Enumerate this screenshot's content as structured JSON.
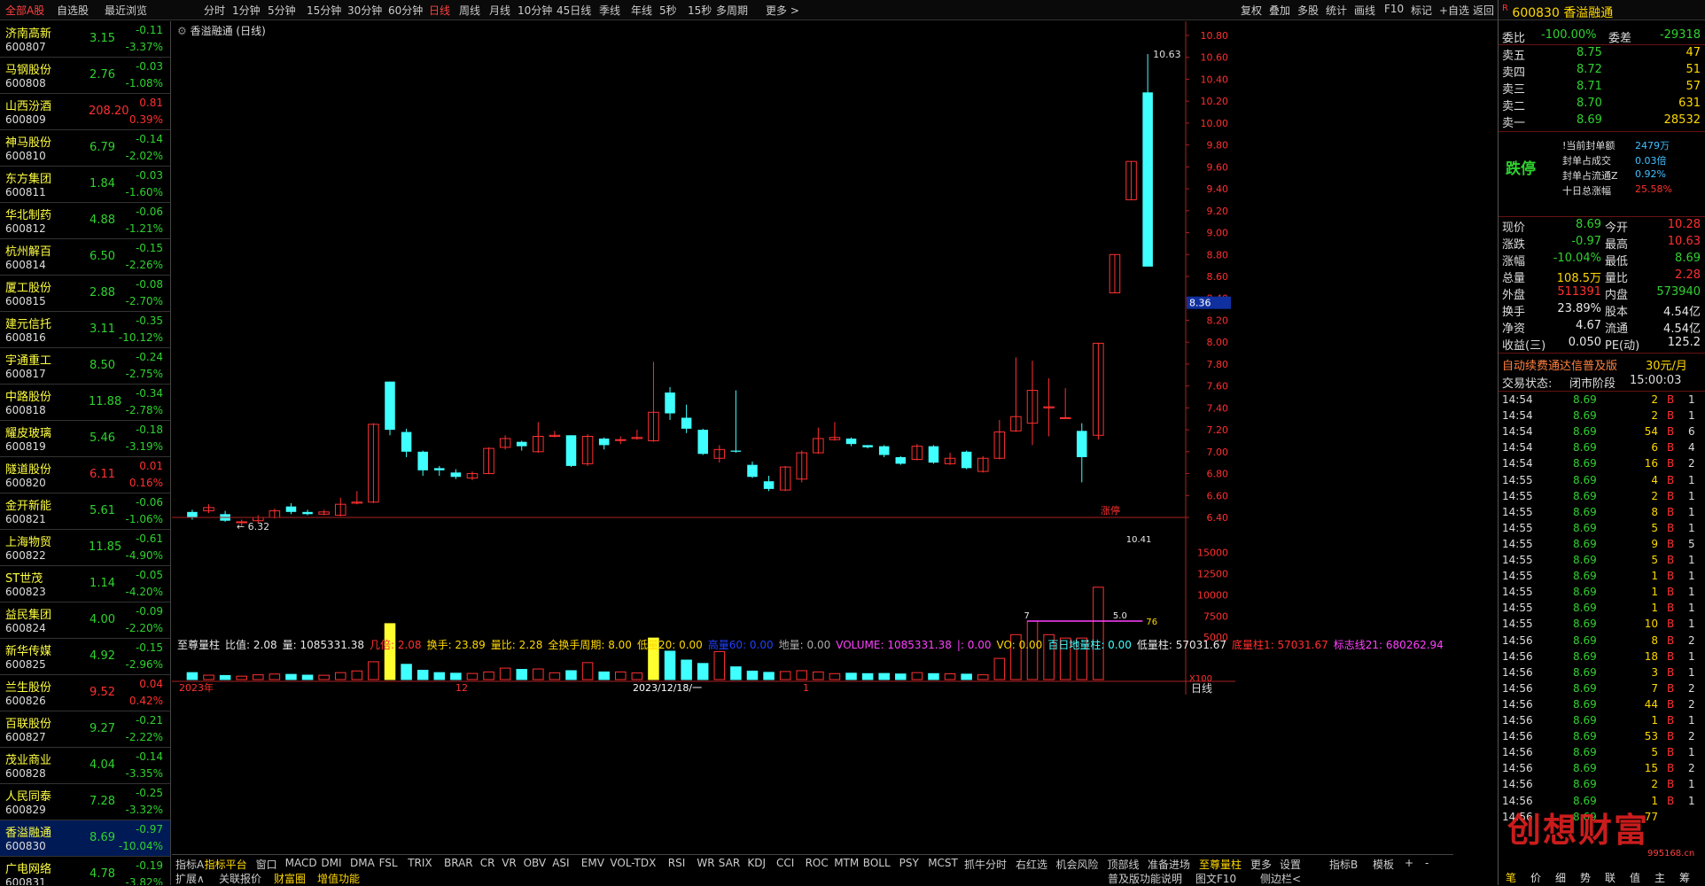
{
  "topbar": {
    "tabs": [
      "全部A股",
      "自选股",
      "最近浏览"
    ],
    "periods": [
      "指标A",
      "分时",
      "1分钟",
      "5分钟",
      "15分钟",
      "30分钟",
      "60分钟",
      "日线",
      "周线",
      "月线",
      "10分钟",
      "45日线",
      "季线",
      "年线",
      "5秒",
      "15秒",
      "多周期",
      "更多"
    ],
    "tools": [
      "复权",
      "叠加",
      "多股",
      "统计",
      "画线",
      "F10",
      "标记",
      "+自选",
      "返回"
    ]
  },
  "stocks": [
    {
      "name": "济南高新",
      "code": "600807",
      "price": "3.15",
      "chg": "-0.11",
      "pct": "-3.37%",
      "dir": "dn"
    },
    {
      "name": "马钢股份",
      "code": "600808",
      "price": "2.76",
      "chg": "-0.03",
      "pct": "-1.08%",
      "dir": "dn"
    },
    {
      "name": "山西汾酒",
      "code": "600809",
      "price": "208.20",
      "chg": "0.81",
      "pct": "0.39%",
      "dir": "up"
    },
    {
      "name": "神马股份",
      "code": "600810",
      "price": "6.79",
      "chg": "-0.14",
      "pct": "-2.02%",
      "dir": "dn"
    },
    {
      "name": "东方集团",
      "code": "600811",
      "price": "1.84",
      "chg": "-0.03",
      "pct": "-1.60%",
      "dir": "dn"
    },
    {
      "name": "华北制药",
      "code": "600812",
      "price": "4.88",
      "chg": "-0.06",
      "pct": "-1.21%",
      "dir": "dn"
    },
    {
      "name": "杭州解百",
      "code": "600814",
      "price": "6.50",
      "chg": "-0.15",
      "pct": "-2.26%",
      "dir": "dn"
    },
    {
      "name": "厦工股份",
      "code": "600815",
      "price": "2.88",
      "chg": "-0.08",
      "pct": "-2.70%",
      "dir": "dn"
    },
    {
      "name": "建元信托",
      "code": "600816",
      "price": "3.11",
      "chg": "-0.35",
      "pct": "-10.12%",
      "dir": "dn"
    },
    {
      "name": "宇通重工",
      "code": "600817",
      "price": "8.50",
      "chg": "-0.24",
      "pct": "-2.75%",
      "dir": "dn"
    },
    {
      "name": "中路股份",
      "code": "600818",
      "price": "11.88",
      "chg": "-0.34",
      "pct": "-2.78%",
      "dir": "dn"
    },
    {
      "name": "耀皮玻璃",
      "code": "600819",
      "price": "5.46",
      "chg": "-0.18",
      "pct": "-3.19%",
      "dir": "dn"
    },
    {
      "name": "隧道股份",
      "code": "600820",
      "price": "6.11",
      "chg": "0.01",
      "pct": "0.16%",
      "dir": "up"
    },
    {
      "name": "金开新能",
      "code": "600821",
      "price": "5.61",
      "chg": "-0.06",
      "pct": "-1.06%",
      "dir": "dn"
    },
    {
      "name": "上海物贸",
      "code": "600822",
      "price": "11.85",
      "chg": "-0.61",
      "pct": "-4.90%",
      "dir": "dn"
    },
    {
      "name": "ST世茂",
      "code": "600823",
      "price": "1.14",
      "chg": "-0.05",
      "pct": "-4.20%",
      "dir": "dn"
    },
    {
      "name": "益民集团",
      "code": "600824",
      "price": "4.00",
      "chg": "-0.09",
      "pct": "-2.20%",
      "dir": "dn"
    },
    {
      "name": "新华传媒",
      "code": "600825",
      "price": "4.92",
      "chg": "-0.15",
      "pct": "-2.96%",
      "dir": "dn"
    },
    {
      "name": "兰生股份",
      "code": "600826",
      "price": "9.52",
      "chg": "0.04",
      "pct": "0.42%",
      "dir": "up"
    },
    {
      "name": "百联股份",
      "code": "600827",
      "price": "9.27",
      "chg": "-0.21",
      "pct": "-2.22%",
      "dir": "dn"
    },
    {
      "name": "茂业商业",
      "code": "600828",
      "price": "4.04",
      "chg": "-0.14",
      "pct": "-3.35%",
      "dir": "dn"
    },
    {
      "name": "人民同泰",
      "code": "600829",
      "price": "7.28",
      "chg": "-0.25",
      "pct": "-3.32%",
      "dir": "dn"
    },
    {
      "name": "香溢融通",
      "code": "600830",
      "price": "8.69",
      "chg": "-0.97",
      "pct": "-10.04%",
      "dir": "dn",
      "selected": true
    },
    {
      "name": "广电网络",
      "code": "600831",
      "price": "4.78",
      "chg": "-0.19",
      "pct": "-3.82%",
      "dir": "dn"
    }
  ],
  "chart": {
    "title": "香溢融通 (日线)",
    "high_label": "10.63",
    "low_label": "6.32",
    "price_marker": "8.36",
    "limit_tag": "涨停",
    "x_labels": [
      "2023年",
      "12",
      "2023/12/18/一",
      "1"
    ],
    "y_ticks": [
      "10.80",
      "10.60",
      "10.40",
      "10.20",
      "10.00",
      "9.80",
      "9.60",
      "9.40",
      "9.20",
      "9.00",
      "8.80",
      "8.60",
      "8.40",
      "8.20",
      "8.00",
      "7.80",
      "7.60",
      "7.40",
      "7.20",
      "7.00",
      "6.80",
      "6.60",
      "6.40"
    ],
    "vol_ticks": [
      "15000",
      "12500",
      "10000",
      "7500",
      "5000"
    ],
    "vol_unit": "X100",
    "vol_notes": [
      "7",
      "5.0",
      "76",
      "10.41"
    ],
    "indicator_line": [
      {
        "t": "至尊量柱",
        "c": "#e8e8e8"
      },
      {
        "t": "比值: 2.08",
        "c": "#e8e8e8"
      },
      {
        "t": "量: 1085331.38",
        "c": "#e8e8e8"
      },
      {
        "t": "几倍: 2.08",
        "c": "#ff3030"
      },
      {
        "t": "换手: 23.89",
        "c": "#ffd800"
      },
      {
        "t": "量比: 2.28",
        "c": "#ffd800"
      },
      {
        "t": "全换手周期: 8.00",
        "c": "#ffd800"
      },
      {
        "t": "低量20: 0.00",
        "c": "#ffd800"
      },
      {
        "t": "高量60: 0.00",
        "c": "#2040ff"
      },
      {
        "t": "地量: 0.00",
        "c": "#aaaaaa"
      },
      {
        "t": "VOLUME: 1085331.38",
        "c": "#ff40ff"
      },
      {
        "t": "|: 0.00",
        "c": "#ff40ff"
      },
      {
        "t": "VO: 0.00",
        "c": "#ffd800"
      },
      {
        "t": "百日地量柱: 0.00",
        "c": "#40ffff"
      },
      {
        "t": "低量柱: 57031.67",
        "c": "#e8e8e8"
      },
      {
        "t": "底量柱1: 57031.67",
        "c": "#ff3030"
      },
      {
        "t": "标志线21: 680262.94",
        "c": "#ff40ff"
      }
    ],
    "time_unit": "日线"
  },
  "chart_data": {
    "type": "candlestick",
    "candles": [
      [
        6.45,
        6.4,
        6.47,
        6.38
      ],
      [
        6.46,
        6.49,
        6.52,
        6.44
      ],
      [
        6.43,
        6.37,
        6.46,
        6.36
      ],
      [
        6.36,
        6.36,
        6.38,
        6.32
      ],
      [
        6.37,
        6.4,
        6.42,
        6.35
      ],
      [
        6.4,
        6.46,
        6.48,
        6.39
      ],
      [
        6.5,
        6.45,
        6.53,
        6.43
      ],
      [
        6.45,
        6.43,
        6.47,
        6.42
      ],
      [
        6.43,
        6.45,
        6.47,
        6.42
      ],
      [
        6.42,
        6.52,
        6.58,
        6.41
      ],
      [
        6.53,
        6.54,
        6.64,
        6.52
      ],
      [
        6.54,
        7.25,
        7.26,
        6.53
      ],
      [
        7.64,
        7.2,
        7.64,
        7.15
      ],
      [
        7.18,
        7.0,
        7.21,
        6.95
      ],
      [
        7.0,
        6.83,
        7.01,
        6.78
      ],
      [
        6.85,
        6.83,
        6.87,
        6.78
      ],
      [
        6.81,
        6.77,
        6.84,
        6.75
      ],
      [
        6.76,
        6.8,
        6.82,
        6.74
      ],
      [
        6.8,
        7.03,
        7.04,
        6.8
      ],
      [
        7.04,
        7.12,
        7.15,
        7.02
      ],
      [
        7.09,
        7.05,
        7.1,
        7.01
      ],
      [
        7.0,
        7.14,
        7.27,
        6.99
      ],
      [
        7.14,
        7.15,
        7.19,
        7.13
      ],
      [
        7.15,
        6.87,
        7.15,
        6.86
      ],
      [
        6.89,
        7.14,
        7.16,
        6.87
      ],
      [
        7.12,
        7.06,
        7.13,
        7.02
      ],
      [
        7.11,
        7.11,
        7.14,
        7.07
      ],
      [
        7.12,
        7.13,
        7.2,
        7.11
      ],
      [
        7.1,
        7.36,
        7.82,
        7.09
      ],
      [
        7.54,
        7.35,
        7.59,
        7.29
      ],
      [
        7.31,
        7.21,
        7.43,
        7.17
      ],
      [
        7.2,
        6.98,
        7.21,
        6.97
      ],
      [
        6.94,
        7.02,
        7.06,
        6.9
      ],
      [
        7.01,
        7.0,
        7.56,
        6.99
      ],
      [
        6.88,
        6.77,
        6.91,
        6.76
      ],
      [
        6.73,
        6.66,
        6.78,
        6.64
      ],
      [
        6.65,
        6.86,
        6.87,
        6.64
      ],
      [
        6.75,
        6.99,
        7.01,
        6.72
      ],
      [
        6.99,
        7.12,
        7.22,
        6.98
      ],
      [
        7.11,
        7.13,
        7.27,
        7.1
      ],
      [
        7.12,
        7.07,
        7.13,
        7.05
      ],
      [
        7.06,
        7.04,
        7.06,
        7.03
      ],
      [
        7.05,
        6.97,
        7.06,
        6.95
      ],
      [
        6.95,
        6.89,
        6.96,
        6.88
      ],
      [
        6.93,
        7.05,
        7.07,
        6.92
      ],
      [
        7.05,
        6.9,
        7.06,
        6.89
      ],
      [
        6.89,
        6.94,
        6.99,
        6.88
      ],
      [
        7.0,
        6.85,
        7.01,
        6.84
      ],
      [
        6.82,
        6.94,
        6.96,
        6.81
      ],
      [
        6.94,
        7.18,
        7.29,
        6.93
      ],
      [
        7.19,
        7.32,
        7.86,
        7.18
      ],
      [
        7.26,
        7.56,
        7.83,
        7.06
      ],
      [
        7.4,
        7.41,
        7.67,
        7.14
      ],
      [
        7.31,
        7.31,
        7.58,
        7.3
      ],
      [
        7.19,
        6.95,
        7.26,
        6.72
      ],
      [
        7.15,
        7.99,
        7.99,
        7.11
      ],
      [
        8.45,
        8.8,
        8.8,
        8.45
      ],
      [
        9.3,
        9.65,
        9.65,
        9.3
      ],
      [
        10.28,
        8.69,
        10.63,
        8.69
      ]
    ],
    "volumes": [
      820,
      520,
      480,
      400,
      560,
      650,
      610,
      520,
      510,
      820,
      1020,
      2100,
      6600,
      1800,
      1100,
      820,
      750,
      720,
      900,
      1350,
      1200,
      1250,
      800,
      1050,
      2000,
      900,
      900,
      780,
      4900,
      3350,
      2300,
      1900,
      3300,
      1500,
      1000,
      850,
      950,
      1050,
      900,
      700,
      750,
      700,
      720,
      660,
      820,
      700,
      680,
      640,
      560,
      2500,
      5300,
      6900,
      5300,
      4900,
      4900,
      10900
    ],
    "volume_unit": "手 x100",
    "y_range": [
      6.4,
      10.8
    ]
  },
  "quote": {
    "code": "600830",
    "name": "香溢融通",
    "weibi_label": "委比",
    "weibi": "-100.00%",
    "weicha_label": "委差",
    "weicha": "-29318",
    "asks": [
      {
        "label": "卖五",
        "price": "8.75",
        "vol": "47"
      },
      {
        "label": "卖四",
        "price": "8.72",
        "vol": "51"
      },
      {
        "label": "卖三",
        "price": "8.71",
        "vol": "57"
      },
      {
        "label": "卖二",
        "price": "8.70",
        "vol": "631"
      },
      {
        "label": "卖一",
        "price": "8.69",
        "vol": "28532"
      }
    ],
    "status_big": "跌停",
    "seal_info": [
      {
        "k": "!当前封单额",
        "v": "2479万"
      },
      {
        "k": "封单占成交",
        "v": "0.03倍"
      },
      {
        "k": "封单占流通Z",
        "v": "0.92%"
      },
      {
        "k": "十日总涨幅",
        "v": "25.58%"
      }
    ],
    "stats": [
      {
        "k1": "现价",
        "v1": "8.69",
        "c1": "#2fd22f",
        "k2": "今开",
        "v2": "10.28",
        "c2": "#ff3030"
      },
      {
        "k1": "涨跌",
        "v1": "-0.97",
        "c1": "#2fd22f",
        "k2": "最高",
        "v2": "10.63",
        "c2": "#ff3030"
      },
      {
        "k1": "涨幅",
        "v1": "-10.04%",
        "c1": "#2fd22f",
        "k2": "最低",
        "v2": "8.69",
        "c2": "#2fd22f"
      },
      {
        "k1": "总量",
        "v1": "108.5万",
        "c1": "#ffd800",
        "k2": "量比",
        "v2": "2.28",
        "c2": "#ff3030"
      },
      {
        "k1": "外盘",
        "v1": "511391",
        "c1": "#ff3030",
        "k2": "内盘",
        "v2": "573940",
        "c2": "#2fd22f"
      },
      {
        "k1": "换手",
        "v1": "23.89%",
        "c1": "#e8e8e8",
        "k2": "股本",
        "v2": "4.54亿",
        "c2": "#e8e8e8"
      },
      {
        "k1": "净资",
        "v1": "4.67",
        "c1": "#e8e8e8",
        "k2": "流通",
        "v2": "4.54亿",
        "c2": "#e8e8e8"
      },
      {
        "k1": "收益(三)",
        "v1": "0.050",
        "c1": "#e8e8e8",
        "k2": "PE(动)",
        "v2": "125.2",
        "c2": "#e8e8e8"
      }
    ],
    "ad_text": "自动续费通达信普及版",
    "ad_price": "30元/月",
    "trade_state_label": "交易状态:",
    "trade_state": "闭市阶段",
    "trade_time": "15:00:03",
    "ticks": [
      [
        "14:54",
        "8.69",
        "2",
        "B",
        "1"
      ],
      [
        "14:54",
        "8.69",
        "2",
        "B",
        "1"
      ],
      [
        "14:54",
        "8.69",
        "54",
        "B",
        "6"
      ],
      [
        "14:54",
        "8.69",
        "6",
        "B",
        "4"
      ],
      [
        "14:54",
        "8.69",
        "16",
        "B",
        "2"
      ],
      [
        "14:55",
        "8.69",
        "4",
        "B",
        "1"
      ],
      [
        "14:55",
        "8.69",
        "2",
        "B",
        "1"
      ],
      [
        "14:55",
        "8.69",
        "8",
        "B",
        "1"
      ],
      [
        "14:55",
        "8.69",
        "5",
        "B",
        "1"
      ],
      [
        "14:55",
        "8.69",
        "9",
        "B",
        "5"
      ],
      [
        "14:55",
        "8.69",
        "5",
        "B",
        "1"
      ],
      [
        "14:55",
        "8.69",
        "1",
        "B",
        "1"
      ],
      [
        "14:55",
        "8.69",
        "1",
        "B",
        "1"
      ],
      [
        "14:55",
        "8.69",
        "1",
        "B",
        "1"
      ],
      [
        "14:55",
        "8.69",
        "10",
        "B",
        "1"
      ],
      [
        "14:56",
        "8.69",
        "8",
        "B",
        "2"
      ],
      [
        "14:56",
        "8.69",
        "18",
        "B",
        "1"
      ],
      [
        "14:56",
        "8.69",
        "3",
        "B",
        "1"
      ],
      [
        "14:56",
        "8.69",
        "7",
        "B",
        "2"
      ],
      [
        "14:56",
        "8.69",
        "44",
        "B",
        "2"
      ],
      [
        "14:56",
        "8.69",
        "1",
        "B",
        "1"
      ],
      [
        "14:56",
        "8.69",
        "53",
        "B",
        "2"
      ],
      [
        "14:56",
        "8.69",
        "5",
        "B",
        "1"
      ],
      [
        "14:56",
        "8.69",
        "15",
        "B",
        "2"
      ],
      [
        "14:56",
        "8.69",
        "2",
        "B",
        "1"
      ],
      [
        "14:56",
        "8.69",
        "1",
        "B",
        "1"
      ],
      [
        "14:56",
        "8.69",
        "77",
        "",
        " "
      ]
    ],
    "watermark": "创想财富",
    "watermark_url": "995168.cn",
    "bottom_tabs": [
      "笔",
      "价",
      "细",
      "势",
      "联",
      "值",
      "主",
      "筹"
    ]
  },
  "bottom_tabs": {
    "row1": [
      "指标A",
      "指标平台",
      "窗口",
      "MACD",
      "DMI",
      "DMA",
      "FSL",
      "TRIX",
      "BRAR",
      "CR",
      "VR",
      "OBV",
      "ASI",
      "EMV",
      "VOL-TDX",
      "RSI",
      "WR",
      "SAR",
      "KDJ",
      "CCI",
      "ROC",
      "MTM",
      "BOLL",
      "PSY",
      "MCST",
      "抓牛分时",
      "右红选",
      "机会风险",
      "顶部线",
      "准备进场",
      "至尊量柱",
      "更多",
      "设置"
    ],
    "row1_right": [
      "指标B",
      "模板",
      "+",
      "-"
    ],
    "row2": [
      "扩展∧",
      "关联报价",
      "财富圈",
      "增值功能"
    ],
    "row2_right": [
      "普及版功能说明",
      "图文F10",
      "侧边栏<"
    ]
  },
  "colors": {
    "up": "#ff3030",
    "down": "#40ffff",
    "bg": "#000000",
    "axis": "#aa2222"
  }
}
